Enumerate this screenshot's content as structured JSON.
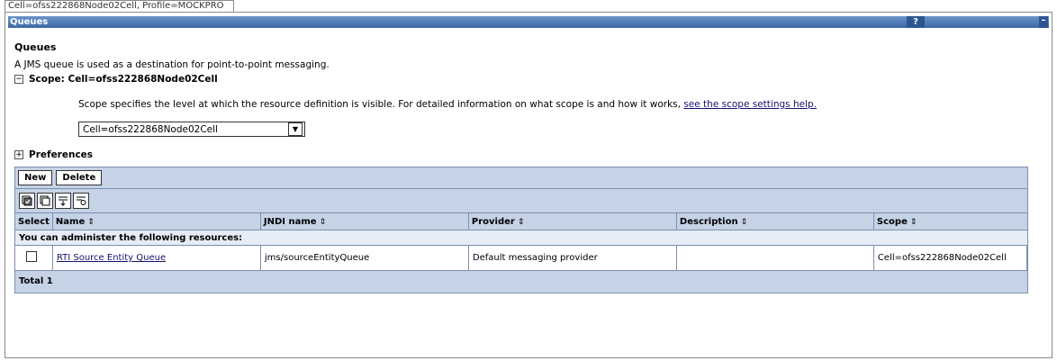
{
  "context": {
    "label": "Cell=ofss222868Node02Cell, Profile=MOCKPRO"
  },
  "portlet": {
    "title": "Queues",
    "help_label": "?",
    "minimize_label": "–"
  },
  "page": {
    "heading": "Queues",
    "description": "A JMS queue is used as a destination for point-to-point messaging."
  },
  "scope": {
    "toggle": "−",
    "label": "Scope: Cell=ofss222868Node02Cell",
    "help_text": "Scope specifies the level at which the resource definition is visible. For detailed information on what scope is and how it works,",
    "help_link": "see the scope settings help.",
    "selected": "Cell=ofss222868Node02Cell"
  },
  "preferences": {
    "toggle": "+",
    "label": "Preferences"
  },
  "toolbar": {
    "new_label": "New",
    "delete_label": "Delete"
  },
  "table": {
    "columns": [
      "Select",
      "Name",
      "JNDI name",
      "Provider",
      "Description",
      "Scope"
    ],
    "admin_note": "You can administer the following resources:",
    "rows": [
      {
        "name": "RTI Source Entity Queue",
        "jndi": "jms/sourceEntityQueue",
        "provider": "Default messaging provider",
        "description": "",
        "scope": "Cell=ofss222868Node02Cell"
      }
    ],
    "total": "Total 1"
  },
  "icons": [
    "select-all-icon",
    "deselect-all-icon",
    "show-filter-icon",
    "clear-filter-icon"
  ]
}
